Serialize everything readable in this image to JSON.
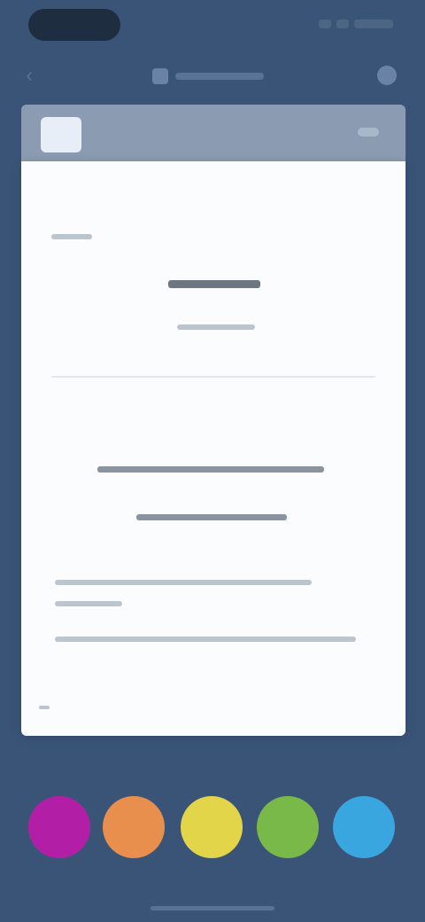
{
  "colors": {
    "background": "#3a5478",
    "swatches": [
      "#b21fa6",
      "#e88f4d",
      "#e2d54a",
      "#79b94a",
      "#3aa6df"
    ]
  },
  "icons": {
    "back": "back-arrow-icon",
    "title": "document-icon",
    "more": "more-options-icon"
  }
}
